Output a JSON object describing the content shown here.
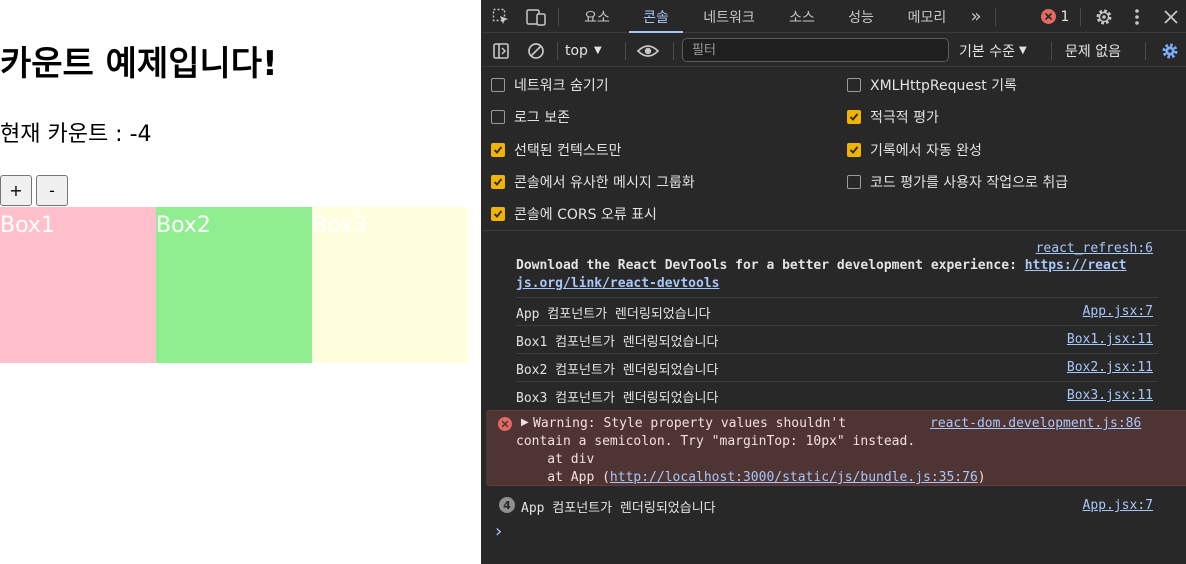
{
  "app": {
    "heading": "카운트 예제입니다!",
    "count_text": "현재 카운트 : -4",
    "plus_label": "+",
    "minus_label": "-",
    "boxes": [
      {
        "label": "Box1",
        "color": "#ffc0cb"
      },
      {
        "label": "Box2",
        "color": "#90ee90"
      },
      {
        "label": "Box3",
        "color": "#ffffe0"
      }
    ]
  },
  "devtools": {
    "tabs": [
      {
        "label": "요소",
        "active": false
      },
      {
        "label": "콘솔",
        "active": true
      },
      {
        "label": "네트워크",
        "active": false
      },
      {
        "label": "소스",
        "active": false
      },
      {
        "label": "성능",
        "active": false
      },
      {
        "label": "메모리",
        "active": false
      }
    ],
    "more_tabs_icon": "»",
    "error_count": "1",
    "toolbar": {
      "context": "top",
      "filter_placeholder": "필터",
      "levels": "기본 수준",
      "issues": "문제 없음"
    },
    "settings": {
      "left": [
        {
          "label": "네트워크 숨기기",
          "checked": false
        },
        {
          "label": "로그 보존",
          "checked": false
        },
        {
          "label": "선택된 컨텍스트만",
          "checked": true
        },
        {
          "label": "콘솔에서 유사한 메시지 그룹화",
          "checked": true
        },
        {
          "label": "콘솔에 CORS 오류 표시",
          "checked": true
        }
      ],
      "right": [
        {
          "label": "XMLHttpRequest 기록",
          "checked": false
        },
        {
          "label": "적극적 평가",
          "checked": true
        },
        {
          "label": "기록에서 자동 완성",
          "checked": true
        },
        {
          "label": "코드 평가를 사용자 작업으로 취급",
          "checked": false
        }
      ]
    },
    "console": {
      "refresh_source": "react_refresh:6",
      "devtools_text": "Download the React DevTools for a better development experience: ",
      "devtools_link_1": "https://react",
      "devtools_link_2": "js.org/link/react-devtools",
      "messages": [
        {
          "text": "App 컴포넌트가 렌더링되었습니다",
          "source": "App.jsx:7"
        },
        {
          "text": "Box1 컴포넌트가 렌더링되었습니다",
          "source": "Box1.jsx:11"
        },
        {
          "text": "Box2 컴포넌트가 렌더링되었습니다",
          "source": "Box2.jsx:11"
        },
        {
          "text": "Box3 컴포넌트가 렌더링되었습니다",
          "source": "Box3.jsx:11"
        }
      ],
      "warning": {
        "line1": "Warning: Style property values shouldn't",
        "source": "react-dom.development.js:86",
        "line2": "contain a semicolon. Try \"marginTop: 10px\" instead.",
        "line3": "    at div",
        "line4_prefix": "    at App (",
        "line4_link": "http://localhost:3000/static/js/bundle.js:35:76",
        "line4_suffix": ")"
      },
      "repeat": {
        "count": "4",
        "text": "App 컴포넌트가 렌더링되었습니다",
        "source": "App.jsx:7"
      },
      "prompt": "›"
    }
  }
}
